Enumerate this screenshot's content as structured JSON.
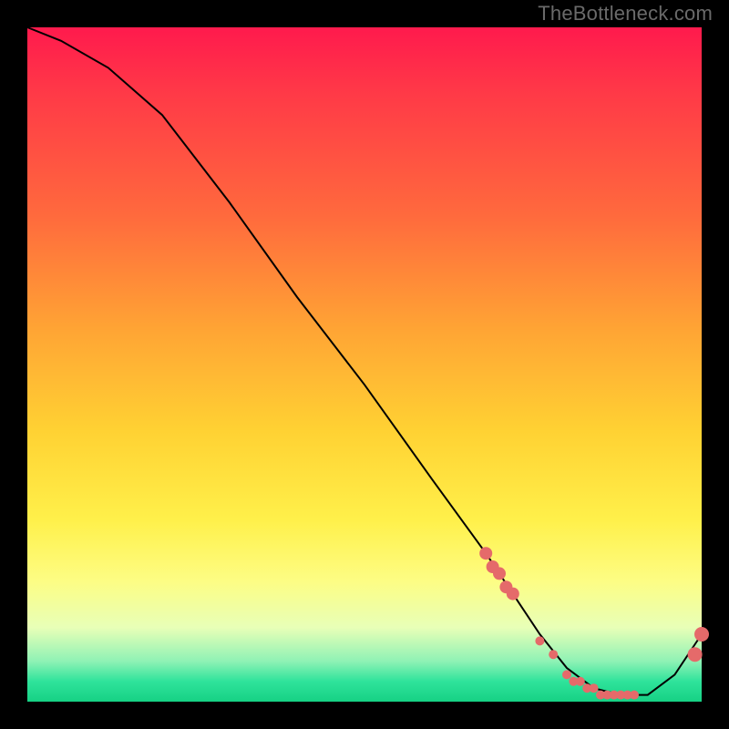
{
  "watermark": "TheBottleneck.com",
  "colors": {
    "background": "#000000",
    "curve": "#000000",
    "marker": "#e56a6a",
    "gradient_top": "#ff1a4d",
    "gradient_bottom": "#16d184"
  },
  "chart_data": {
    "type": "line",
    "title": "",
    "xlabel": "",
    "ylabel": "",
    "xlim": [
      0,
      100
    ],
    "ylim": [
      0,
      100
    ],
    "grid": false,
    "curve": {
      "x": [
        0,
        5,
        12,
        20,
        30,
        40,
        50,
        60,
        68,
        72,
        76,
        80,
        84,
        88,
        92,
        96,
        100
      ],
      "y": [
        100,
        98,
        94,
        87,
        74,
        60,
        47,
        33,
        22,
        16,
        10,
        5,
        2,
        1,
        1,
        4,
        10
      ]
    },
    "markers": {
      "x": [
        68,
        69,
        70,
        71,
        72,
        76,
        78,
        80,
        81,
        82,
        83,
        84,
        85,
        86,
        87,
        88,
        89,
        90,
        99,
        100
      ],
      "y": [
        22,
        20,
        19,
        17,
        16,
        9,
        7,
        4,
        3,
        3,
        2,
        2,
        1,
        1,
        1,
        1,
        1,
        1,
        7,
        10
      ]
    }
  }
}
